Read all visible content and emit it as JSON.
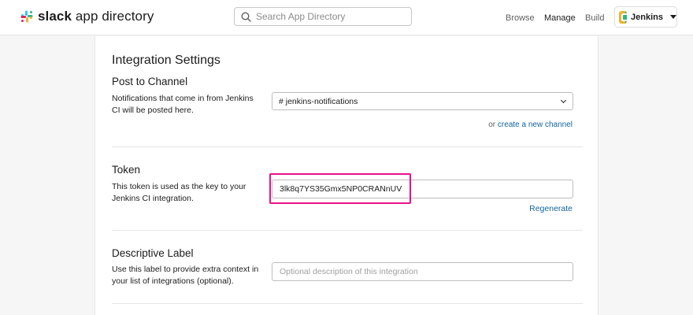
{
  "header": {
    "logo_bold": "slack",
    "logo_rest": " app directory",
    "search_placeholder": "Search App Directory",
    "nav": {
      "browse": "Browse",
      "manage": "Manage",
      "build": "Build"
    },
    "workspace": "Jenkins"
  },
  "settings": {
    "title": "Integration Settings",
    "post_to_channel": {
      "title": "Post to Channel",
      "description": "Notifications that come in from Jenkins CI will be posted here.",
      "selected_channel": "# jenkins-notifications",
      "or_text": "or ",
      "create_link": "create a new channel"
    },
    "token": {
      "title": "Token",
      "description": "This token is used as the key to your Jenkins CI integration.",
      "value": "3lk8q7YS35Gmx5NP0CRANnUV",
      "regenerate": "Regenerate"
    },
    "descriptive_label": {
      "title": "Descriptive Label",
      "description": "Use this label to provide extra context in your list of integrations (optional).",
      "placeholder": "Optional description of this integration",
      "value": ""
    }
  },
  "colors": {
    "link": "#1264a3",
    "highlight": "#e8118a"
  }
}
